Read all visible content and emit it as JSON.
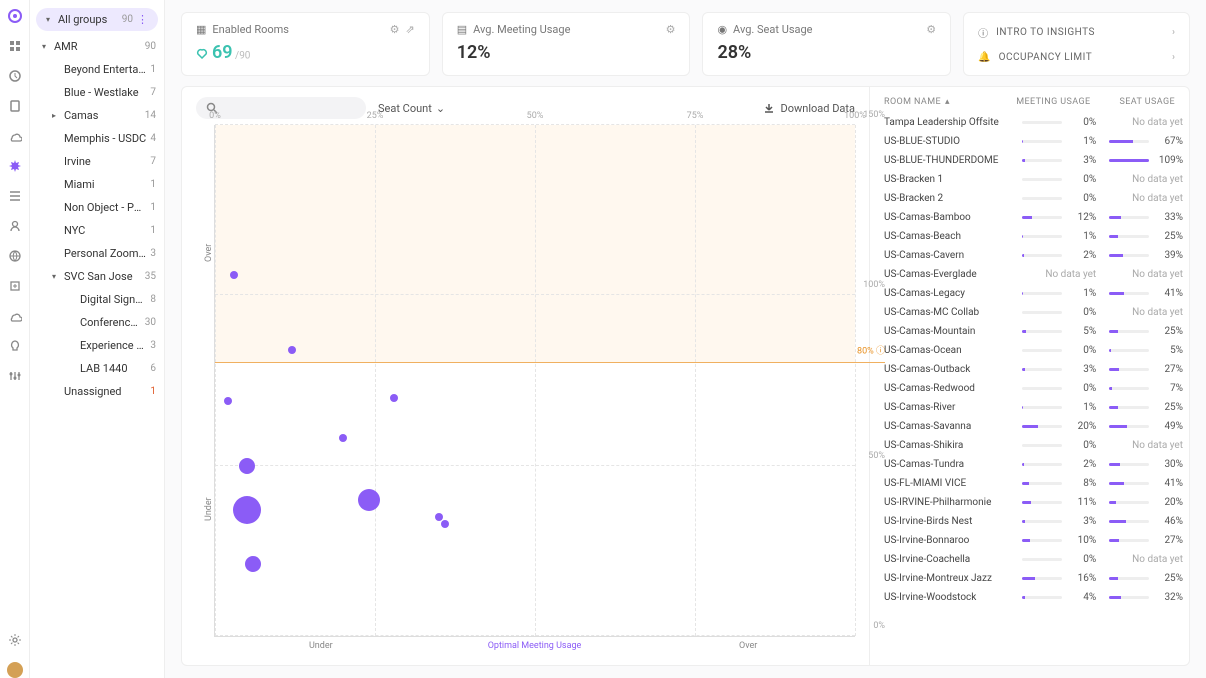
{
  "sidebar": {
    "allGroups": {
      "label": "All groups",
      "count": 90
    },
    "tree": [
      {
        "label": "AMR",
        "count": 90,
        "caret": "▾",
        "level": 0
      },
      {
        "label": "Beyond Entertainm...",
        "count": 1,
        "level": 1
      },
      {
        "label": "Blue - Westlake",
        "count": 7,
        "level": 1
      },
      {
        "label": "Camas",
        "count": 14,
        "caret": "▸",
        "level": 1
      },
      {
        "label": "Memphis - USDC",
        "count": 4,
        "level": 1
      },
      {
        "label": "Irvine",
        "count": 7,
        "level": 1
      },
      {
        "label": "Miami",
        "count": 1,
        "level": 1
      },
      {
        "label": "Non Object - Port...",
        "count": 1,
        "level": 1
      },
      {
        "label": "NYC",
        "count": 1,
        "level": 1
      },
      {
        "label": "Personal ZoomRo...",
        "count": 3,
        "level": 1
      },
      {
        "label": "SVC San Jose",
        "count": 35,
        "caret": "▾",
        "level": 1
      },
      {
        "label": "Digital Signage",
        "count": 8,
        "level": 2
      },
      {
        "label": "Conference Roo...",
        "count": 30,
        "level": 2
      },
      {
        "label": "Experience Center",
        "count": 3,
        "level": 2
      },
      {
        "label": "LAB 1440",
        "count": 6,
        "level": 2
      },
      {
        "label": "Unassigned",
        "count": 1,
        "level": 1,
        "warn": true
      }
    ]
  },
  "cards": {
    "enabled": {
      "title": "Enabled Rooms",
      "value": 69,
      "total": 90
    },
    "meeting": {
      "title": "Avg. Meeting Usage",
      "value": "12%"
    },
    "seat": {
      "title": "Avg. Seat Usage",
      "value": "28%"
    },
    "links": [
      {
        "icon": "info",
        "label": "INTRO TO INSIGHTS"
      },
      {
        "icon": "bell",
        "label": "OCCUPANCY LIMIT"
      }
    ]
  },
  "toolbar": {
    "sort": "Seat Count",
    "download": "Download Data"
  },
  "chart_data": {
    "type": "scatter",
    "xlabel_segments": [
      "Under",
      "Optimal Meeting Usage",
      "Over"
    ],
    "ylabel_segments": [
      "Under",
      "Over"
    ],
    "xlim": [
      0,
      100
    ],
    "ylim": [
      0,
      150
    ],
    "xticks": [
      0,
      25,
      50,
      75,
      100
    ],
    "yticks": [
      0,
      50,
      100,
      150
    ],
    "threshold_y": 80,
    "threshold_label": "80% ⓘ",
    "bubbles": [
      {
        "x": 3,
        "y": 106,
        "r": 4
      },
      {
        "x": 12,
        "y": 84,
        "r": 4
      },
      {
        "x": 2,
        "y": 69,
        "r": 4
      },
      {
        "x": 28,
        "y": 70,
        "r": 4
      },
      {
        "x": 20,
        "y": 58,
        "r": 4
      },
      {
        "x": 5,
        "y": 50,
        "r": 8
      },
      {
        "x": 24,
        "y": 40,
        "r": 11
      },
      {
        "x": 35,
        "y": 35,
        "r": 4
      },
      {
        "x": 5,
        "y": 37,
        "r": 14
      },
      {
        "x": 36,
        "y": 33,
        "r": 4
      },
      {
        "x": 6,
        "y": 21,
        "r": 8
      }
    ]
  },
  "table": {
    "headers": [
      "ROOM NAME",
      "MEETING USAGE",
      "SEAT USAGE"
    ],
    "rows": [
      {
        "name": "Tampa Leadership Offsite",
        "mu": 0,
        "su": null
      },
      {
        "name": "US-BLUE-STUDIO",
        "mu": 1,
        "su": 67
      },
      {
        "name": "US-BLUE-THUNDERDOME",
        "mu": 3,
        "su": 109
      },
      {
        "name": "US-Bracken 1",
        "mu": 0,
        "su": null
      },
      {
        "name": "US-Bracken 2",
        "mu": 0,
        "su": null
      },
      {
        "name": "US-Camas-Bamboo",
        "mu": 12,
        "su": 33
      },
      {
        "name": "US-Camas-Beach",
        "mu": 1,
        "su": 25
      },
      {
        "name": "US-Camas-Cavern",
        "mu": 2,
        "su": 39
      },
      {
        "name": "US-Camas-Everglade",
        "mu": null,
        "su": null
      },
      {
        "name": "US-Camas-Legacy",
        "mu": 1,
        "su": 41
      },
      {
        "name": "US-Camas-MC Collab",
        "mu": 0,
        "su": null
      },
      {
        "name": "US-Camas-Mountain",
        "mu": 5,
        "su": 25
      },
      {
        "name": "US-Camas-Ocean",
        "mu": 0,
        "su": 5
      },
      {
        "name": "US-Camas-Outback",
        "mu": 3,
        "su": 27
      },
      {
        "name": "US-Camas-Redwood",
        "mu": 0,
        "su": 7
      },
      {
        "name": "US-Camas-River",
        "mu": 1,
        "su": 25
      },
      {
        "name": "US-Camas-Savanna",
        "mu": 20,
        "su": 49
      },
      {
        "name": "US-Camas-Shikira",
        "mu": 0,
        "su": null
      },
      {
        "name": "US-Camas-Tundra",
        "mu": 2,
        "su": 30
      },
      {
        "name": "US-FL-MIAMI VICE",
        "mu": 8,
        "su": 41
      },
      {
        "name": "US-IRVINE-Philharmonie",
        "mu": 11,
        "su": 20
      },
      {
        "name": "US-Irvine-Birds Nest",
        "mu": 3,
        "su": 46
      },
      {
        "name": "US-Irvine-Bonnaroo",
        "mu": 10,
        "su": 27
      },
      {
        "name": "US-Irvine-Coachella",
        "mu": 0,
        "su": null
      },
      {
        "name": "US-Irvine-Montreux Jazz",
        "mu": 16,
        "su": 25
      },
      {
        "name": "US-Irvine-Woodstock",
        "mu": 4,
        "su": 32
      }
    ],
    "nodata": "No data yet"
  }
}
